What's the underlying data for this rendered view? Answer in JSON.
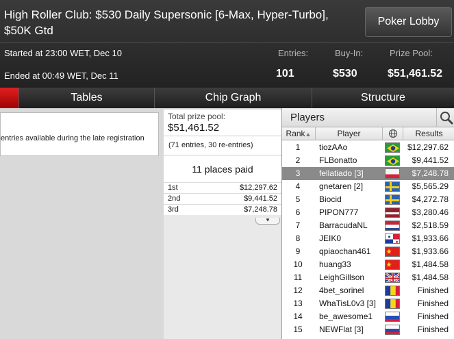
{
  "header": {
    "title": "High Roller Club: $530 Daily Supersonic [6-Max, Hyper-Turbo], $50K Gtd",
    "lobby_button": "Poker Lobby",
    "started": "Started at 23:00 WET, Dec 10",
    "ended": "Ended at 00:49 WET, Dec 11",
    "entries_label": "Entries:",
    "entries_value": "101",
    "buyin_label": "Buy-In:",
    "buyin_value": "$530",
    "prizepool_label": "Prize Pool:",
    "prizepool_value": "$51,461.52"
  },
  "tabs": [
    "Tables",
    "Chip Graph",
    "Structure"
  ],
  "left_panel": {
    "message": "entries available during the late registration"
  },
  "prize_pool": {
    "label": "Total prize pool:",
    "value": "$51,461.52",
    "entries_note": "(71 entries, 30 re-entries)",
    "places_paid": "11 places paid",
    "payouts": [
      {
        "place": "1st",
        "amount": "$12,297.62"
      },
      {
        "place": "2nd",
        "amount": "$9,441.52"
      },
      {
        "place": "3rd",
        "amount": "$7,248.78"
      }
    ],
    "more_icon": "double-chevron-down"
  },
  "players": {
    "title": "Players",
    "search_icon": "magnifier",
    "columns": {
      "rank": "Rank",
      "player": "Player",
      "flag": "globe",
      "results": "Results"
    },
    "selected_rank": "3",
    "rows": [
      {
        "rank": "1",
        "name": "tiozAAo",
        "flag": "brazil",
        "result": "$12,297.62"
      },
      {
        "rank": "2",
        "name": "FLBonatto",
        "flag": "brazil",
        "result": "$9,441.52"
      },
      {
        "rank": "3",
        "name": "fellatiado [3]",
        "flag": "poland",
        "result": "$7,248.78"
      },
      {
        "rank": "4",
        "name": "gnetaren [2]",
        "flag": "sweden",
        "result": "$5,565.29"
      },
      {
        "rank": "5",
        "name": "Biocid",
        "flag": "sweden",
        "result": "$4,272.78"
      },
      {
        "rank": "6",
        "name": "PIPON777",
        "flag": "latvia",
        "result": "$3,280.46"
      },
      {
        "rank": "7",
        "name": "BarracudaNL",
        "flag": "netherlands",
        "result": "$2,518.59"
      },
      {
        "rank": "8",
        "name": "JEIK0",
        "flag": "panama",
        "result": "$1,933.66"
      },
      {
        "rank": "9",
        "name": "qpiaochan461",
        "flag": "china",
        "result": "$1,933.66"
      },
      {
        "rank": "10",
        "name": "huang33",
        "flag": "china",
        "result": "$1,484.58"
      },
      {
        "rank": "11",
        "name": "LeighGillson",
        "flag": "uk",
        "result": "$1,484.58"
      },
      {
        "rank": "12",
        "name": "4bet_sorinel",
        "flag": "romania",
        "result": "Finished"
      },
      {
        "rank": "13",
        "name": "WhaTisL0v3 [3]",
        "flag": "romania",
        "result": "Finished"
      },
      {
        "rank": "14",
        "name": "be_awesome1",
        "flag": "russia",
        "result": "Finished"
      },
      {
        "rank": "15",
        "name": "NEWFlat [3]",
        "flag": "russia",
        "result": "Finished"
      }
    ]
  },
  "colors": {
    "accent_red": "#d01818",
    "selected_row": "#8a8a8a",
    "header_bg": "#2a2a2a"
  }
}
